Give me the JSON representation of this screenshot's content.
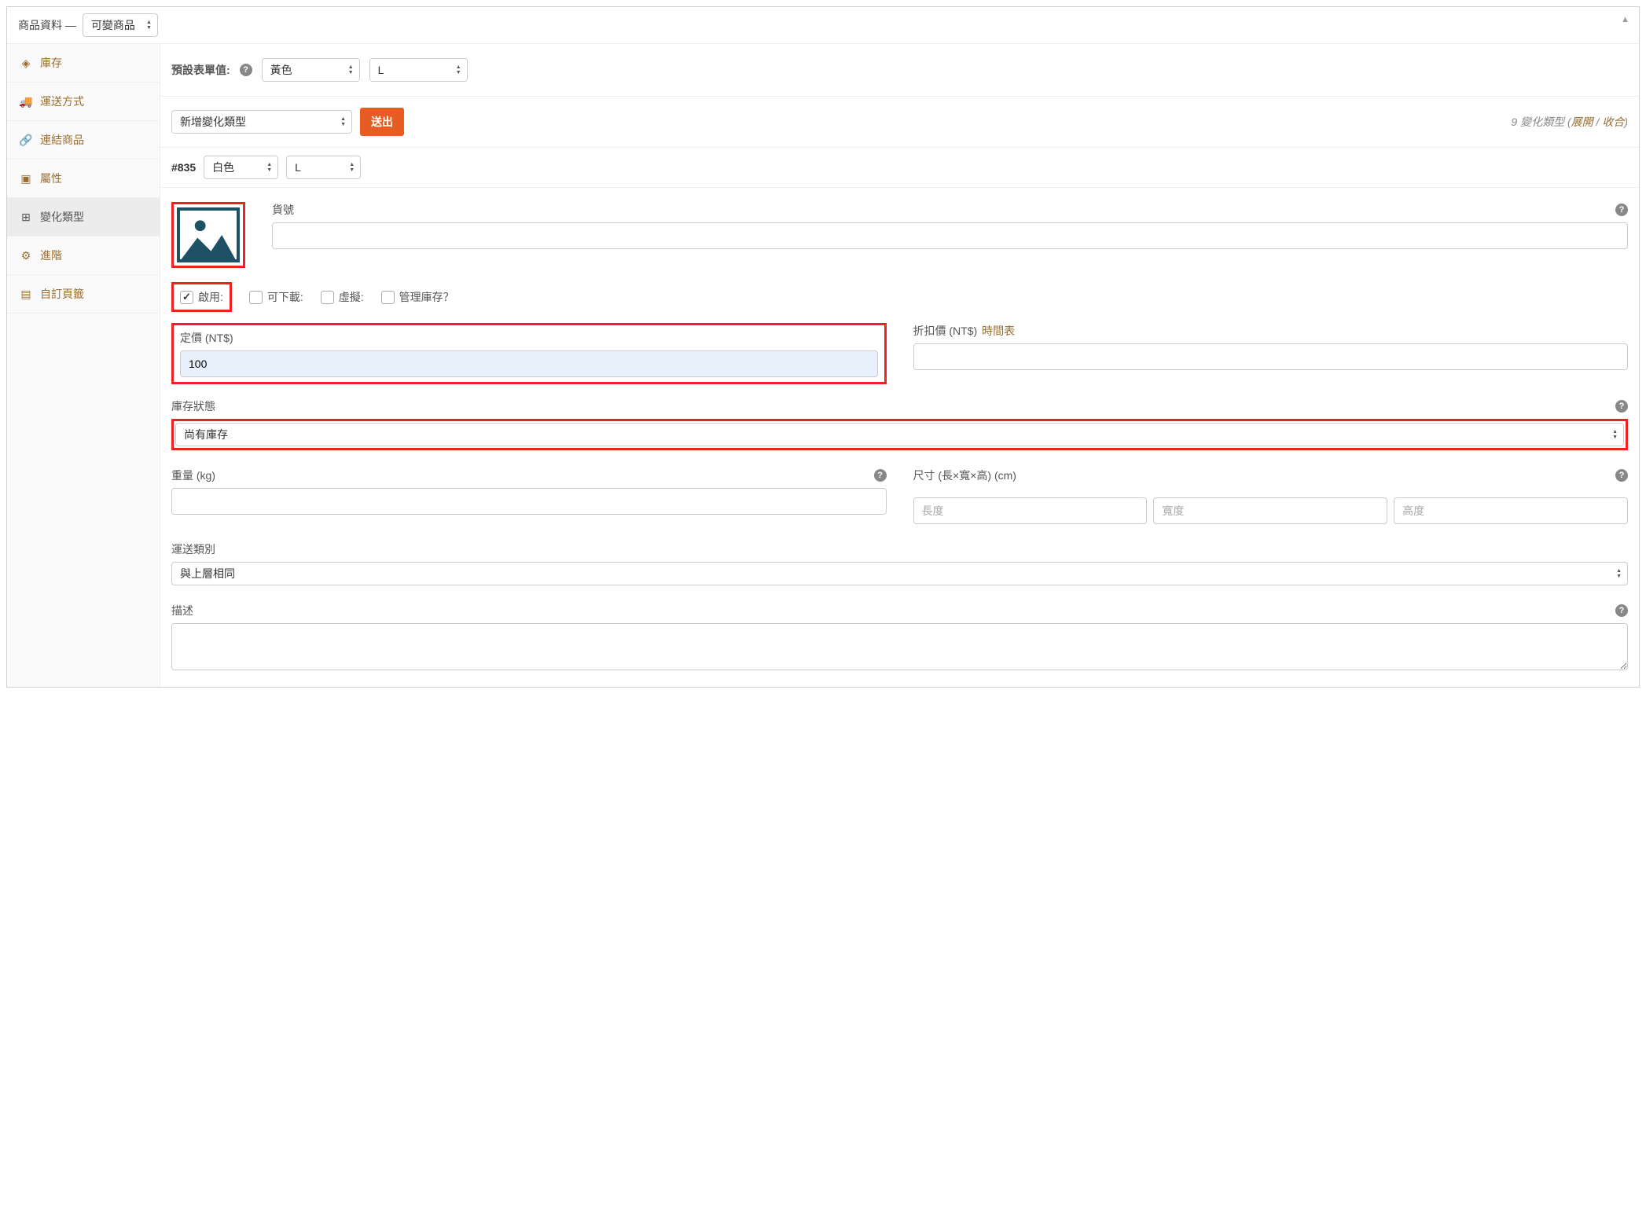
{
  "header": {
    "title": "商品資料 —",
    "product_type": "可變商品"
  },
  "sidebar": {
    "items": [
      {
        "icon": "tag",
        "label": "庫存"
      },
      {
        "icon": "truck",
        "label": "運送方式"
      },
      {
        "icon": "link",
        "label": "連結商品"
      },
      {
        "icon": "card",
        "label": "屬性"
      },
      {
        "icon": "grid",
        "label": "變化類型",
        "active": true
      },
      {
        "icon": "gear",
        "label": "進階"
      },
      {
        "icon": "bookmark",
        "label": "自訂頁籤"
      }
    ]
  },
  "defaults": {
    "label": "預設表單值:",
    "color": "黃色",
    "size": "L"
  },
  "action": {
    "dropdown": "新增變化類型",
    "submit": "送出",
    "count": "9",
    "count_suffix": " 變化類型 (",
    "expand": "展開",
    "sep": " / ",
    "collapse": "收合",
    "close_paren": ")"
  },
  "variation": {
    "id": "#835",
    "color": "白色",
    "size": "L",
    "sku_label": "貨號",
    "sku_value": "",
    "checkboxes": {
      "enable": "啟用:",
      "downloadable": "可下載:",
      "virtual": "虛擬:",
      "manage_stock": "管理庫存？"
    },
    "regular_price_label": "定價 (NT$)",
    "regular_price_value": "100",
    "sale_price_label": "折扣價 (NT$) ",
    "schedule_link": "時間表",
    "sale_price_value": "",
    "stock_status_label": "庫存狀態",
    "stock_status_value": "尚有庫存",
    "weight_label": "重量 (kg)",
    "weight_value": "",
    "dims_label": "尺寸 (長×寬×高) (cm)",
    "dims": {
      "length_ph": "長度",
      "width_ph": "寬度",
      "height_ph": "高度"
    },
    "shipping_class_label": "運送類別",
    "shipping_class_value": "與上層相同",
    "description_label": "描述",
    "description_value": ""
  }
}
